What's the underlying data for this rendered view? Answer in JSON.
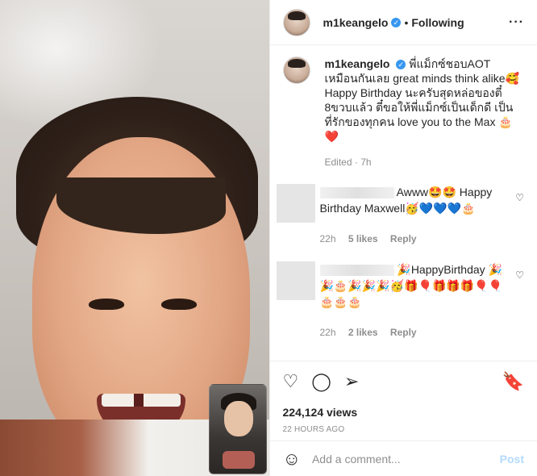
{
  "header": {
    "username": "m1keangelo",
    "separator": "•",
    "follow_state": "Following",
    "more": "···"
  },
  "caption": {
    "username": "m1keangelo",
    "text": "พี่แม็กซ์ชอบAOT เหมือนกันเลย great minds think alike🥰\nHappy Birthday นะครับสุดหล่อของตี๋ 8ขวบแล้ว ตี๋ขอให้พี่แม็กซ์เป็นเด็กดี เป็นที่รักของทุกคน love you to the Max 🎂\n❤️",
    "edited": "Edited · 7h"
  },
  "comments": [
    {
      "text": "Awww🤩🤩 Happy Birthday Maxwell🥳💙💙💙🎂",
      "time": "22h",
      "likes": "5 likes",
      "reply": "Reply",
      "like_icon": "♡"
    },
    {
      "text": "🎉HappyBirthday 🎉🎉🎂🎉🎉🎉🥳🎁🎈🎁🎁🎁🎈🎈🎂🎂🎂",
      "time": "22h",
      "likes": "2 likes",
      "reply": "Reply",
      "like_icon": "♡"
    }
  ],
  "actions": {
    "like_icon": "♡",
    "comment_icon": "◯",
    "share_icon": "➢",
    "save_icon": "🔖"
  },
  "views": "224,124 views",
  "time_ago": "22 HOURS AGO",
  "add_comment": {
    "placeholder": "Add a comment...",
    "post_label": "Post",
    "emoji_icon": "☺"
  }
}
